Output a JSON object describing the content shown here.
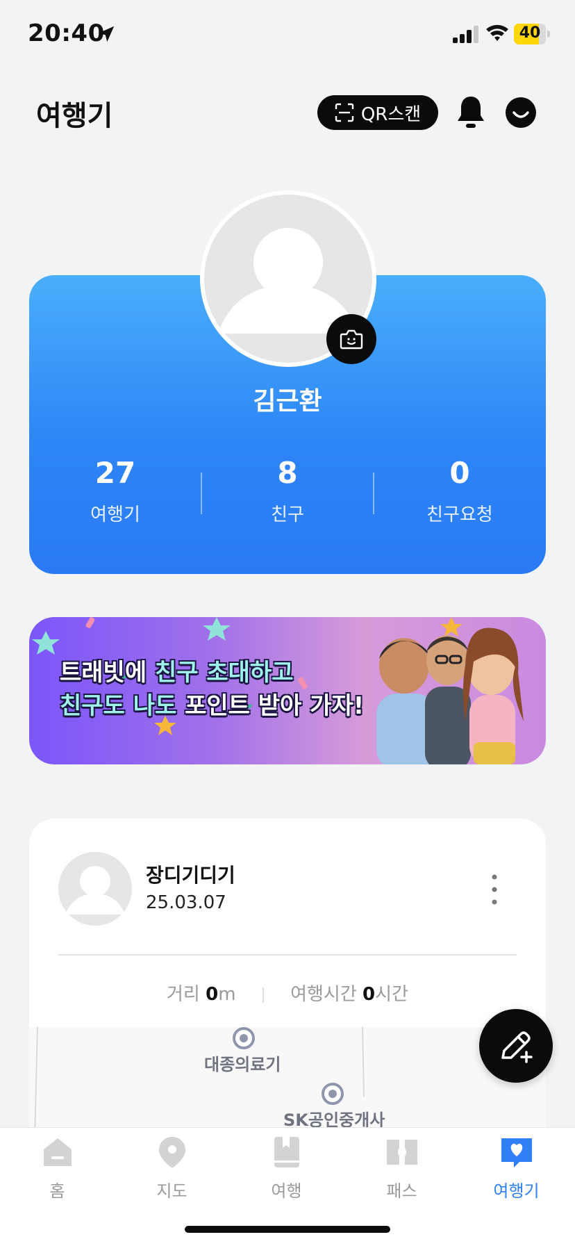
{
  "status_bar": {
    "time": "20:40",
    "battery": "40"
  },
  "header": {
    "title": "여행기",
    "qr_label": "QR스캔"
  },
  "profile": {
    "name": "김근환",
    "stats": [
      {
        "value": "27",
        "label": "여행기"
      },
      {
        "value": "8",
        "label": "친구"
      },
      {
        "value": "0",
        "label": "친구요청"
      }
    ]
  },
  "banner": {
    "line1_a": "트래빗에 ",
    "line1_b": "친구 초대하고",
    "line2_a": "친구도 ",
    "line2_b": "나도",
    "line2_c": " 포인트 받아 가자!"
  },
  "post": {
    "author": "장디기디기",
    "date": "25.03.07",
    "distance_label": "거리",
    "distance_value": "0",
    "distance_unit": "m",
    "time_label": "여행시간",
    "time_value": "0",
    "time_unit": "시간",
    "map_labels": [
      "대종의료기",
      "SK공인중개사"
    ]
  },
  "tabs": [
    {
      "label": "홈",
      "icon": "home-icon",
      "active": false
    },
    {
      "label": "지도",
      "icon": "map-pin-icon",
      "active": false
    },
    {
      "label": "여행",
      "icon": "book-icon",
      "active": false
    },
    {
      "label": "패스",
      "icon": "ticket-icon",
      "active": false
    },
    {
      "label": "여행기",
      "icon": "heart-chat-icon",
      "active": true
    }
  ],
  "colors": {
    "accent": "#2f80f7",
    "card_top": "#4aaefb",
    "card_bottom": "#2a7af5",
    "battery": "#ffd60a"
  }
}
